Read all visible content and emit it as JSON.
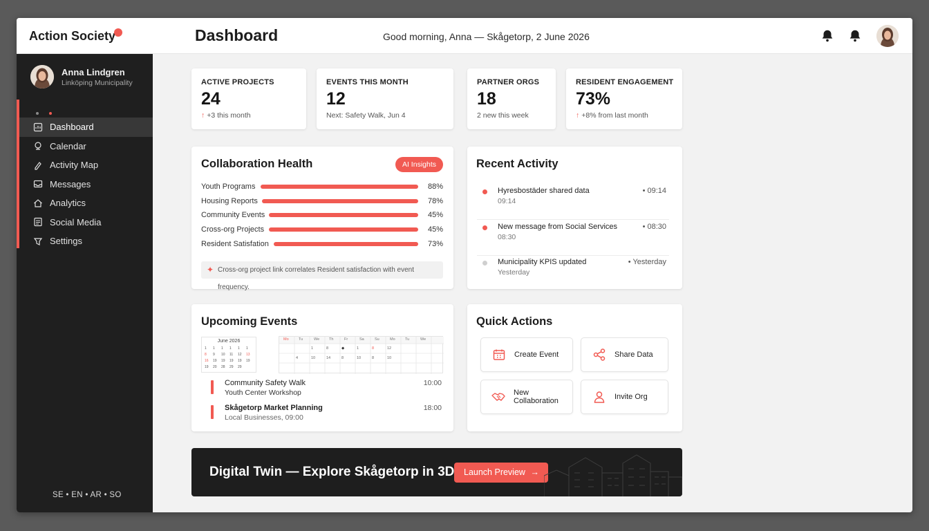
{
  "app": {
    "brand": "Action Society",
    "page_title": "Dashboard",
    "greeting": "Good morning, Anna — Skågetorp, 2 June 2026"
  },
  "colors": {
    "accent": "#f15a52",
    "sidebar_bg": "#1f1f1f",
    "banner_bg": "#1e1e1e"
  },
  "top_icons": [
    "bell-icon",
    "bell-icon",
    "avatar"
  ],
  "profile": {
    "name": "Anna Lindgren",
    "org": "Linköping Municipality"
  },
  "nav": [
    {
      "label": "Dashboard",
      "icon": "dashboard-icon",
      "active": true
    },
    {
      "label": "Calendar",
      "icon": "calendar-icon"
    },
    {
      "label": "Activity Map",
      "icon": "map-pin-icon"
    },
    {
      "label": "Messages",
      "icon": "messages-icon"
    },
    {
      "label": "Analytics",
      "icon": "home-icon"
    },
    {
      "label": "Social Media",
      "icon": "social-icon"
    },
    {
      "label": "Settings",
      "icon": "settings-icon"
    }
  ],
  "languages": "SE • EN • AR • SO",
  "kpis": [
    {
      "label": "ACTIVE PROJECTS",
      "value": "24",
      "arrow": "↑",
      "sub": "+3 this month"
    },
    {
      "label": "EVENTS THIS MONTH",
      "value": "12",
      "arrow": "",
      "sub": "Next: Safety Walk, Jun 4"
    },
    {
      "label": "PARTNER ORGS",
      "value": "18",
      "arrow": "",
      "sub": "2 new this week"
    },
    {
      "label": "RESIDENT ENGAGEMENT",
      "value": "73%",
      "arrow": "↑",
      "sub": "+8% from last month"
    }
  ],
  "collab": {
    "title": "Collaboration Health",
    "pill": "AI Insights",
    "rows": [
      {
        "label": "Youth Programs",
        "pct_text": "88%",
        "pct": 88
      },
      {
        "label": "Housing Reports",
        "pct_text": "78%",
        "pct": 78
      },
      {
        "label": "Community Events",
        "pct_text": "45%",
        "pct": 45
      },
      {
        "label": "Cross-org Projects",
        "pct_text": "45%",
        "pct": 45
      },
      {
        "label": "Resident Satisfation",
        "pct_text": "73%",
        "pct": 73
      }
    ],
    "insight": "Cross-org project link correlates Resident satisfaction with event frequency."
  },
  "activity": {
    "title": "Recent Activity",
    "items": [
      {
        "title": "Hyresbostäder shared data",
        "sub": "09:14",
        "time": "• 09:14",
        "dot": "#f15a52"
      },
      {
        "title": "New message from Social Services",
        "sub": "08:30",
        "time": "• 08:30",
        "dot": "#f15a52"
      },
      {
        "title": "Municipality KPIS updated",
        "sub": "Yesterday",
        "time": "• Yesterday",
        "dot": "#cfcfcf"
      }
    ]
  },
  "events": {
    "title": "Upcoming Events",
    "mini_month": "June 2026",
    "grid_headers": [
      "Mo",
      "Tu",
      "We",
      "Th",
      "Fr",
      "Sa",
      "Su",
      "Mo",
      "Tu",
      "We"
    ],
    "items": [
      {
        "title": "Community Safety Walk",
        "sub": "Youth Center Workshop",
        "time": "10:00"
      },
      {
        "title": "Skågetorp Market Planning",
        "sub": "Local Businesses, 09:00",
        "time": "18:00"
      }
    ]
  },
  "quick_actions": {
    "title": "Quick Actions",
    "buttons": [
      {
        "label": "Create Event",
        "icon": "calendar-plus-icon"
      },
      {
        "label": "Share Data",
        "icon": "share-icon"
      },
      {
        "label": "New Collaboration",
        "icon": "handshake-icon"
      },
      {
        "label": "Invite Org",
        "icon": "user-icon"
      }
    ]
  },
  "banner": {
    "title": "Digital Twin — Explore Skågetorp in 3D",
    "button": "Launch Preview",
    "button_arrow": "→"
  }
}
